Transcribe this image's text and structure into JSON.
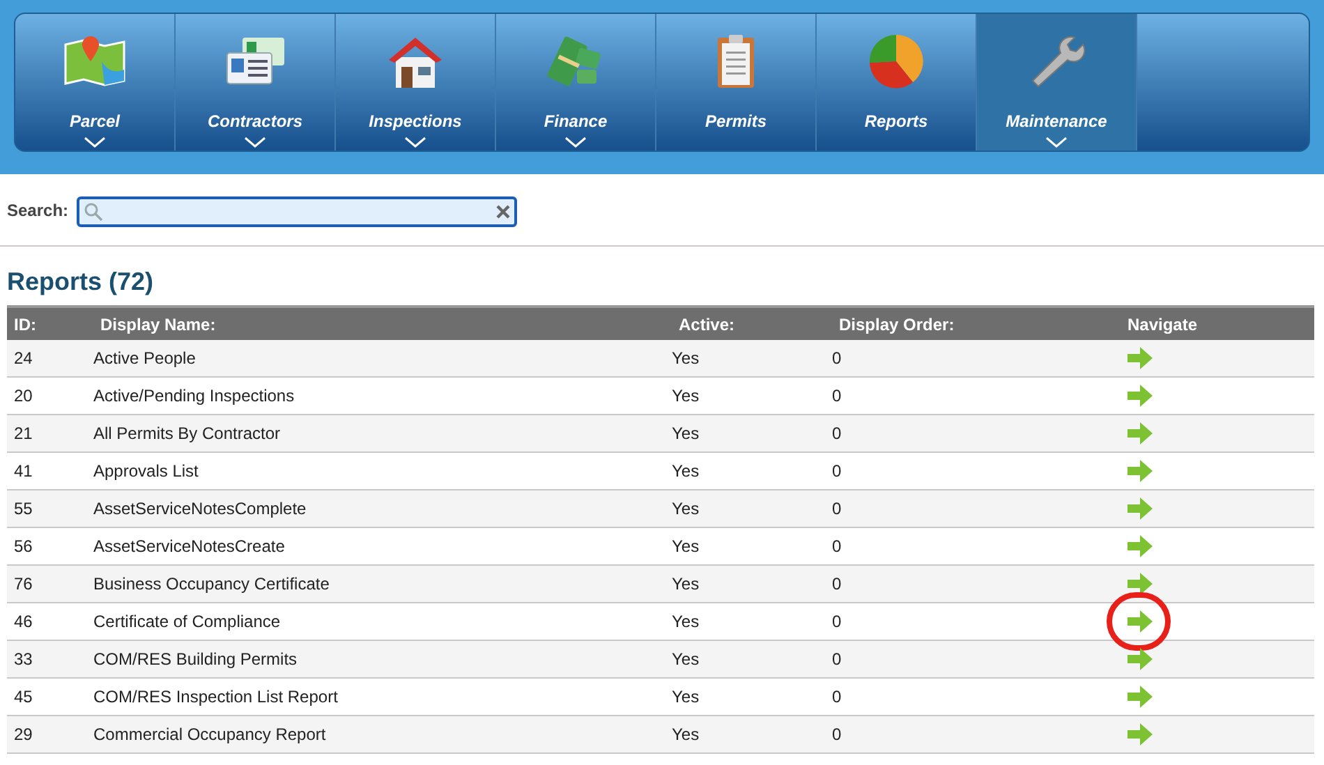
{
  "nav": [
    {
      "label": "Parcel",
      "has_menu": true,
      "selected": false
    },
    {
      "label": "Contractors",
      "has_menu": true,
      "selected": false
    },
    {
      "label": "Inspections",
      "has_menu": true,
      "selected": false
    },
    {
      "label": "Finance",
      "has_menu": true,
      "selected": false
    },
    {
      "label": "Permits",
      "has_menu": false,
      "selected": false
    },
    {
      "label": "Reports",
      "has_menu": false,
      "selected": false
    },
    {
      "label": "Maintenance",
      "has_menu": true,
      "selected": true
    }
  ],
  "search": {
    "label": "Search:"
  },
  "heading": "Reports (72)",
  "table": {
    "columns": [
      "ID:",
      "Display Name:",
      "Active:",
      "Display Order:",
      "Navigate"
    ],
    "rows": [
      {
        "id": "24",
        "name": "Active People",
        "active": "Yes",
        "order": "0",
        "circled": false
      },
      {
        "id": "20",
        "name": "Active/Pending Inspections",
        "active": "Yes",
        "order": "0",
        "circled": false
      },
      {
        "id": "21",
        "name": "All Permits By Contractor",
        "active": "Yes",
        "order": "0",
        "circled": false
      },
      {
        "id": "41",
        "name": "Approvals List",
        "active": "Yes",
        "order": "0",
        "circled": false
      },
      {
        "id": "55",
        "name": "AssetServiceNotesComplete",
        "active": "Yes",
        "order": "0",
        "circled": false
      },
      {
        "id": "56",
        "name": "AssetServiceNotesCreate",
        "active": "Yes",
        "order": "0",
        "circled": false
      },
      {
        "id": "76",
        "name": "Business Occupancy Certificate",
        "active": "Yes",
        "order": "0",
        "circled": false
      },
      {
        "id": "46",
        "name": "Certificate of Compliance",
        "active": "Yes",
        "order": "0",
        "circled": true
      },
      {
        "id": "33",
        "name": "COM/RES Building Permits",
        "active": "Yes",
        "order": "0",
        "circled": false
      },
      {
        "id": "45",
        "name": "COM/RES Inspection List Report",
        "active": "Yes",
        "order": "0",
        "circled": false
      },
      {
        "id": "29",
        "name": "Commercial Occupancy Report",
        "active": "Yes",
        "order": "0",
        "circled": false
      }
    ]
  }
}
